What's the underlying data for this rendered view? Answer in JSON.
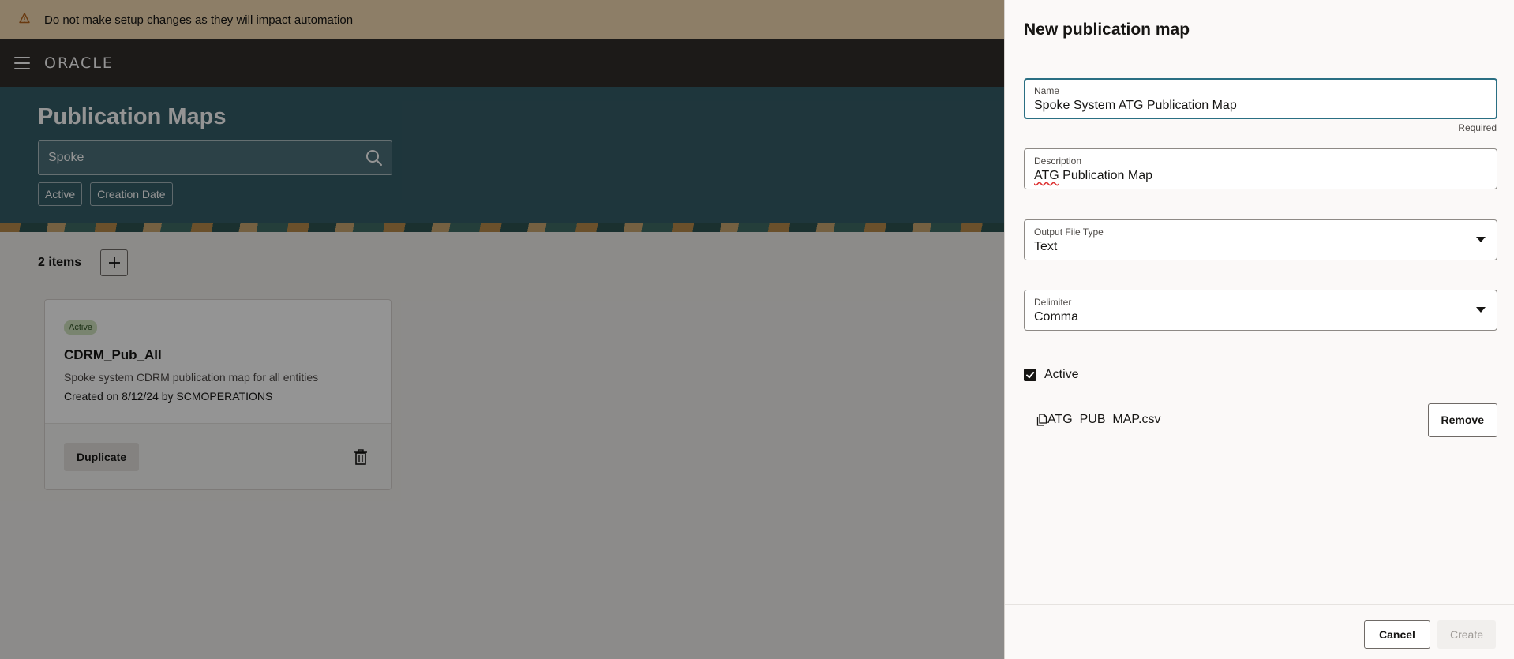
{
  "banner": {
    "icon": "warning-icon",
    "text": "Do not make setup changes as they will impact automation"
  },
  "topbar": {
    "menu_icon": "hamburger-menu-icon",
    "logo": "ORACLE"
  },
  "page": {
    "title": "Publication Maps",
    "search": {
      "value": "Spoke",
      "icon": "search-icon"
    },
    "filters": [
      "Active",
      "Creation Date"
    ],
    "items_count": "2 items",
    "add_icon": "plus-icon"
  },
  "card": {
    "badge": "Active",
    "title": "CDRM_Pub_All",
    "description": "Spoke system CDRM publication map for all entities",
    "created": "Created on 8/12/24 by SCMOPERATIONS",
    "duplicate_label": "Duplicate",
    "delete_icon": "trash-icon"
  },
  "drawer": {
    "title": "New publication map",
    "name": {
      "label": "Name",
      "value": "Spoke System ATG Publication Map",
      "helper": "Required"
    },
    "description": {
      "label": "Description",
      "value_prefix": "ATG",
      "value_suffix": " Publication Map"
    },
    "output_file_type": {
      "label": "Output File Type",
      "value": "Text"
    },
    "delimiter": {
      "label": "Delimiter",
      "value": "Comma"
    },
    "active": {
      "label": "Active",
      "checked": true
    },
    "file": {
      "icon": "file-icon",
      "name": "ATG_PUB_MAP.csv",
      "remove_label": "Remove"
    },
    "cancel_label": "Cancel",
    "create_label": "Create"
  },
  "colors": {
    "banner_bg": "#f3d9b2",
    "topbar_bg": "#312d2a",
    "hero_bg": "#355d68",
    "focus_border": "#2a6f83",
    "badge_bg": "#d0e4c0"
  }
}
